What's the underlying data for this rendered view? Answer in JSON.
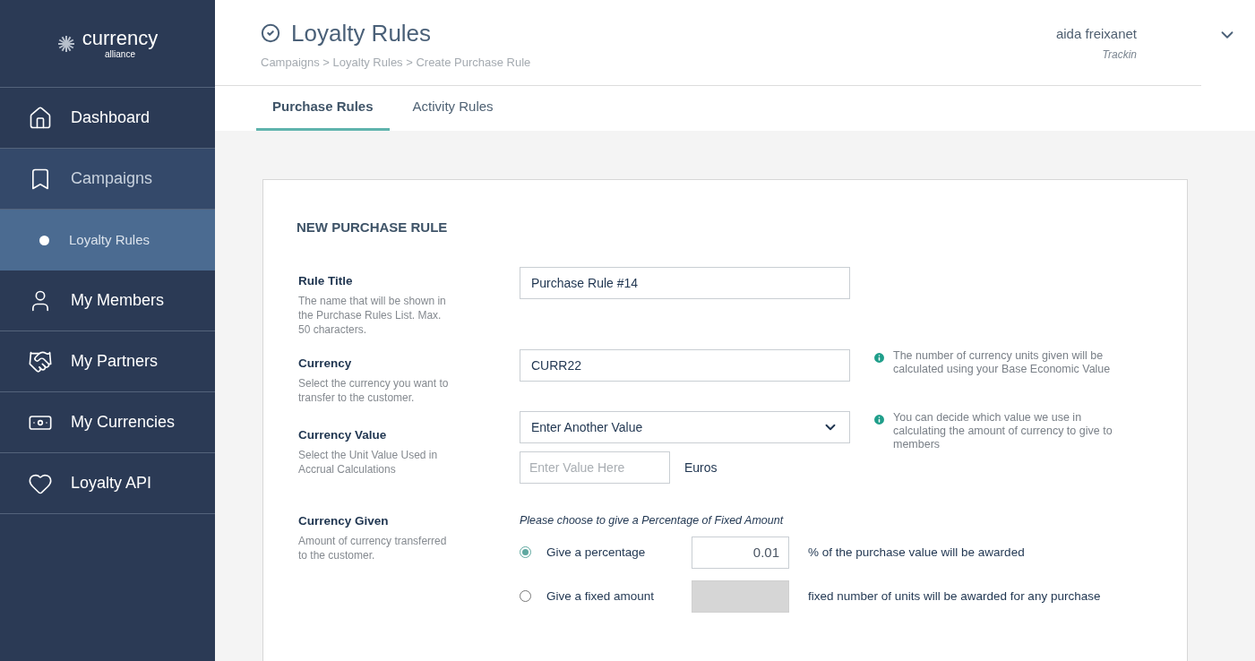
{
  "sidebar": {
    "logo": {
      "name": "currency",
      "sub": "alliance"
    },
    "items": [
      {
        "label": "Dashboard",
        "selected": false,
        "expanded": false
      },
      {
        "label": "Campaigns",
        "selected": false,
        "expanded": true,
        "children": [
          {
            "label": "Loyalty Rules",
            "selected": true
          }
        ]
      },
      {
        "label": "My Members",
        "selected": false,
        "expanded": false
      },
      {
        "label": "My Partners",
        "selected": false,
        "expanded": false
      },
      {
        "label": "My Currencies",
        "selected": false,
        "expanded": false
      },
      {
        "label": "Loyalty API",
        "selected": false,
        "expanded": false
      }
    ]
  },
  "header": {
    "title": "Loyalty Rules",
    "breadcrumb": "Campaigns > Loyalty Rules > Create Purchase Rule",
    "user": {
      "name": "aida freixanet",
      "company": "Trackin"
    }
  },
  "tabs": [
    {
      "label": "Purchase Rules",
      "selected": true
    },
    {
      "label": "Activity Rules",
      "selected": false
    }
  ],
  "form": {
    "heading": "NEW PURCHASE RULE",
    "rows": [
      {
        "kind": "text",
        "label": "Rule Title",
        "help": "The name that will be shown in the Purchase Rules List. Max. 50 characters.",
        "value": "Purchase Rule #14"
      },
      {
        "kind": "text",
        "label": "Currency",
        "help": "Select the currency you want to transfer to the customer.",
        "value": "CURR22",
        "info": "The number of currency units given will be calculated using your Base Economic Value"
      },
      {
        "kind": "select",
        "label": "Currency Value",
        "help": "Select the Unit Value Used in Accrual Calculations",
        "value": "Enter Another Value",
        "placeholder": "Enter Value Here",
        "unit": "Euros",
        "info": "You can decide which value we use in calculating the amount of currency to give to members"
      },
      {
        "kind": "radio",
        "label": "Currency Given",
        "help": "Amount of currency transferred to the customer.",
        "prompt": "Please choose to give a Percentage of Fixed Amount",
        "options": [
          {
            "label": "Give a percentage",
            "selected": true,
            "value": "0.01",
            "suffix": "% of the purchase value will be awarded"
          },
          {
            "label": "Give a fixed amount",
            "selected": false,
            "suffix": "fixed number of units will be awarded for any purchase"
          }
        ]
      }
    ]
  }
}
